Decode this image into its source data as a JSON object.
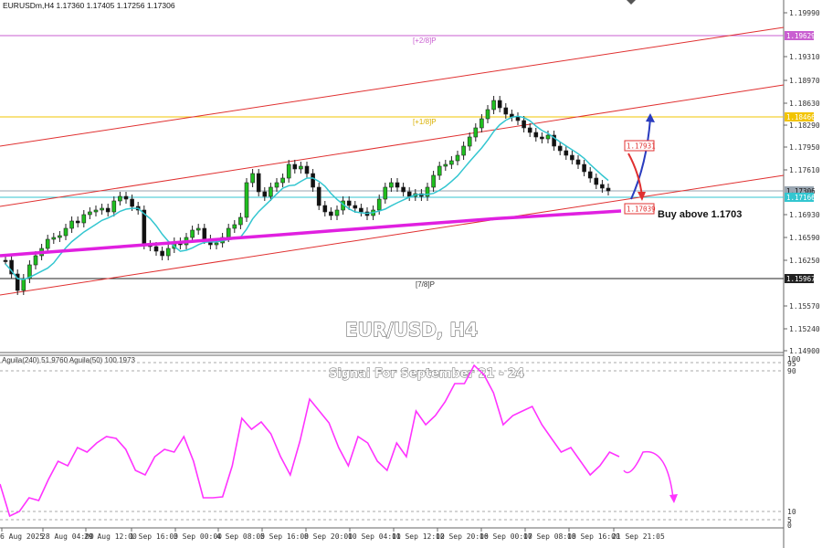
{
  "header": {
    "symbol_line": "EURUSDm,H4  1.17360 1.17405 1.17256 1.17306"
  },
  "price_axis": {
    "ticks": [
      "1.19990",
      "1.19310",
      "1.18970",
      "1.18630",
      "1.18290",
      "1.17950",
      "1.17610",
      "1.16930",
      "1.16590",
      "1.16250",
      "1.15570",
      "1.15240",
      "1.14900"
    ]
  },
  "price_tags": {
    "p28": {
      "label": "1.19629",
      "color": "#c95fd1"
    },
    "p18": {
      "label": "1.18466",
      "color": "#f2c400"
    },
    "ask": {
      "label": "1.17306",
      "color": "#9aa6b2"
    },
    "cyan": {
      "label": "1.17166",
      "color": "#33c6d0"
    },
    "p78": {
      "label": "1.15967",
      "color": "#222222"
    }
  },
  "level_labels": {
    "p28": "[+2/8]P",
    "p18": "[+1/8]P",
    "p78": "[7/8]P"
  },
  "annotations": {
    "target": "1.17931",
    "support": "1.17039",
    "buy_text": "Buy above 1.1703",
    "title": "EUR/USD, H4",
    "signal_title": "Signal For September 21 - 24"
  },
  "indicator": {
    "header": "Aguila(240) 51.9760  Aguila(50) 100.1973",
    "ticks": [
      "100",
      "95",
      "90",
      "10",
      "5",
      "0"
    ],
    "color": "#ff33ff"
  },
  "time_axis": {
    "labels": [
      "6 Aug 2025",
      "28 Aug 04:00",
      "29 Aug 12:00",
      "1 Sep 16:00",
      "3 Sep 00:00",
      "4 Sep 08:00",
      "5 Sep 16:00",
      "8 Sep 20:00",
      "10 Sep 04:00",
      "11 Sep 12:00",
      "12 Sep 20:00",
      "16 Sep 00:00",
      "17 Sep 08:00",
      "18 Sep 16:00",
      "21 Sep 21:05"
    ]
  },
  "colors": {
    "bull": "#1fbf1f",
    "bear": "#111111",
    "channel": "#e03030",
    "ma_fast": "#33c6d0",
    "ma_slow": "#e020e0",
    "up_arrow": "#2a3cbf",
    "down_arrow": "#e03030"
  }
}
